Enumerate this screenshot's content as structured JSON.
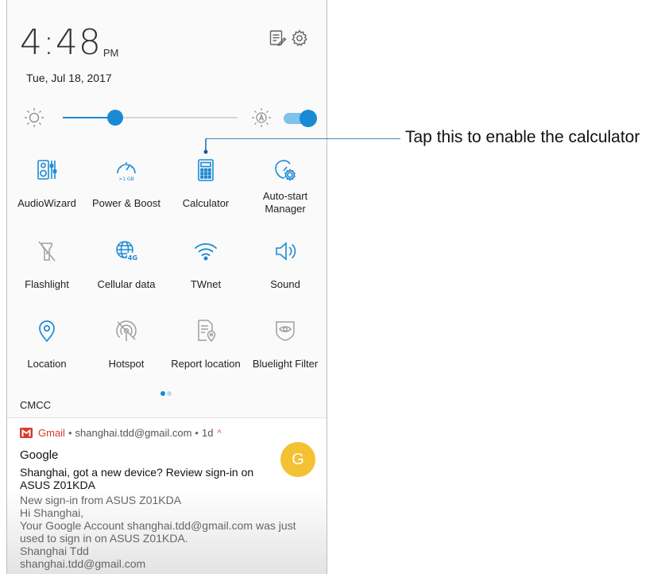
{
  "status": {
    "time": "4:48",
    "ampm": "PM",
    "date": "Tue, Jul 18, 2017",
    "edit_icon": "edit-list-icon",
    "settings_icon": "gear-icon"
  },
  "brightness": {
    "level": 0.3,
    "auto_enabled": true
  },
  "tiles": [
    {
      "label": "AudioWizard",
      "icon": "audiowizard-icon",
      "active": true
    },
    {
      "label": "Power & Boost",
      "icon": "power-boost-icon",
      "active": true,
      "badge": ">1 GB"
    },
    {
      "label": "Calculator",
      "icon": "calculator-icon",
      "active": true
    },
    {
      "label_line1": "Auto-start",
      "label_line2": "Manager",
      "icon": "auto-start-icon",
      "active": true
    },
    {
      "label": "Flashlight",
      "icon": "flashlight-icon",
      "active": false
    },
    {
      "label": "Cellular data",
      "icon": "cellular-data-icon",
      "active": true,
      "badge": "4G"
    },
    {
      "label": "TWnet",
      "icon": "wifi-icon",
      "active": true
    },
    {
      "label": "Sound",
      "icon": "sound-icon",
      "active": true
    },
    {
      "label": "Location",
      "icon": "location-icon",
      "active": true
    },
    {
      "label": "Hotspot",
      "icon": "hotspot-icon",
      "active": false
    },
    {
      "label": "Report location",
      "icon": "report-location-icon",
      "active": false
    },
    {
      "label": "Bluelight Filter",
      "icon": "bluelight-filter-icon",
      "active": false
    }
  ],
  "pager": {
    "pages": 2,
    "current": 1
  },
  "carrier": "CMCC",
  "notification": {
    "app": "Gmail",
    "account": "shanghai.tdd@gmail.com",
    "time": "1d",
    "title": "Google",
    "subject": "Shanghai, got a new device? Review sign-in on ASUS Z01KDA",
    "body_lines": [
      "New sign-in from ASUS Z01KDA",
      "Hi Shanghai,",
      "Your Google Account shanghai.tdd@gmail.com was just",
      "used to sign in on ASUS Z01KDA.",
      "Shanghai Tdd",
      "shanghai.tdd@gmail.com"
    ],
    "avatar_letter": "G"
  },
  "callout": {
    "text": "Tap this to enable the calculator"
  },
  "colors": {
    "accent": "#1a8ad4",
    "inactive": "#9e9e9e",
    "gmail_red": "#d63b2f",
    "avatar": "#f4c133"
  }
}
